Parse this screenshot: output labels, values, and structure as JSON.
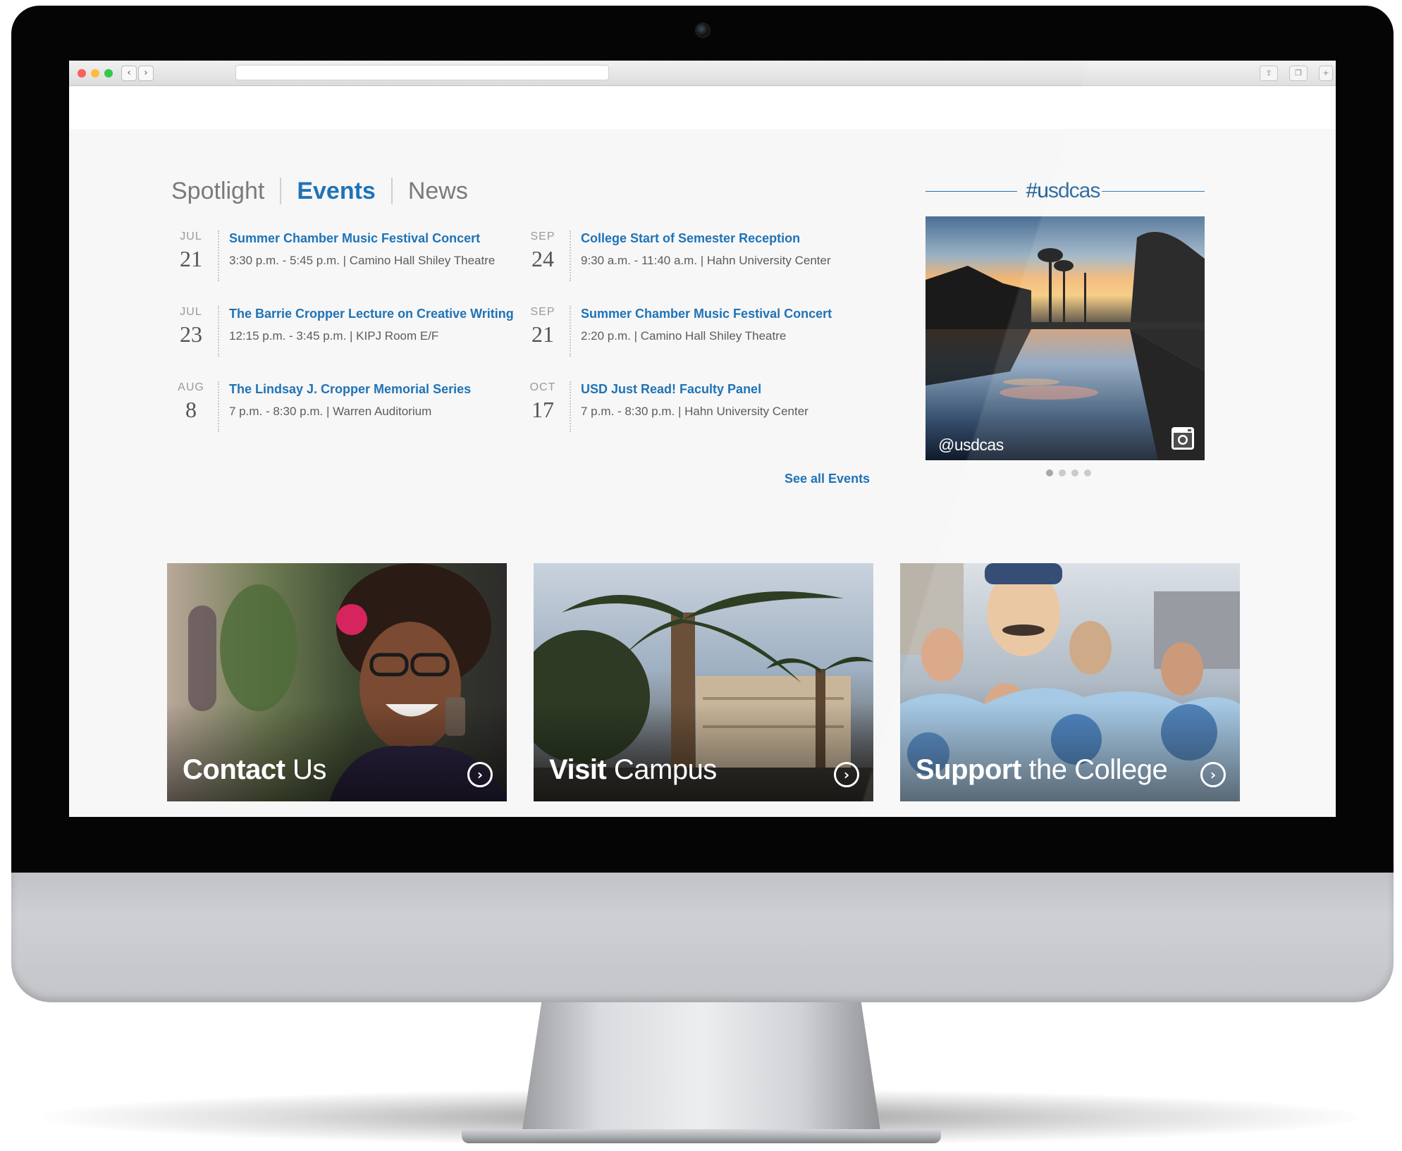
{
  "tabs": [
    {
      "label": "Spotlight",
      "active": false
    },
    {
      "label": "Events",
      "active": true
    },
    {
      "label": "News",
      "active": false
    }
  ],
  "events": [
    {
      "month": "JUL",
      "day": "21",
      "title": "Summer Chamber Music Festival Concert",
      "details": "3:30 p.m. - 5:45 p.m.  |  Camino Hall Shiley Theatre"
    },
    {
      "month": "JUL",
      "day": "23",
      "title": "The Barrie Cropper Lecture on Creative Writing",
      "details": "12:15 p.m. - 3:45 p.m.  |  KIPJ Room E/F"
    },
    {
      "month": "AUG",
      "day": "8",
      "title": "The Lindsay J. Cropper Memorial Series",
      "details": "7 p.m. - 8:30 p.m.  |  Warren Auditorium"
    },
    {
      "month": "SEP",
      "day": "24",
      "title": "College Start of Semester Reception",
      "details": "9:30 a.m. - 11:40 a.m.  |  Hahn University Center"
    },
    {
      "month": "SEP",
      "day": "21",
      "title": "Summer Chamber Music Festival Concert",
      "details": "2:20 p.m.  |  Camino Hall Shiley Theatre"
    },
    {
      "month": "OCT",
      "day": "17",
      "title": "USD Just Read! Faculty Panel",
      "details": "7 p.m. - 8:30 p.m.  |  Hahn University Center"
    }
  ],
  "see_all": "See all Events",
  "instagram": {
    "hashtag": "#usdcas",
    "handle": "@usdcas",
    "icon": "instagram-icon",
    "slides": 4,
    "active_slide": 1
  },
  "cards": [
    {
      "strong": "Contact",
      "light": " Us",
      "icon": "arrow-right-circle-icon"
    },
    {
      "strong": "Visit",
      "light": " Campus",
      "icon": "arrow-right-circle-icon"
    },
    {
      "strong": "Support",
      "light": " the College",
      "icon": "arrow-right-circle-icon"
    }
  ],
  "colors": {
    "accent": "#1f73b7",
    "tab_inactive": "#7a7a7a",
    "page_bg": "#f7f7f7"
  },
  "browser": {
    "back_icon": "chevron-left-icon",
    "forward_icon": "chevron-right-icon",
    "share_icon": "share-icon",
    "tabs_icon": "tabs-icon"
  }
}
